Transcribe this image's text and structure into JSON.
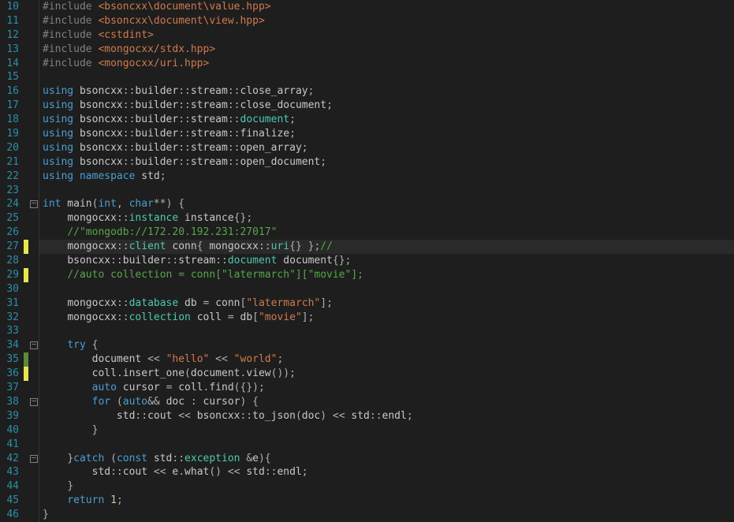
{
  "gutter": {
    "start": 10,
    "end": 46
  },
  "foldMarks": {
    "24": "box",
    "34": "box",
    "38": "box",
    "42": "box"
  },
  "markers": {
    "27": "yellow",
    "29": "yellow",
    "35": "green",
    "36": "yellow"
  },
  "currentLine": 27,
  "lines": [
    {
      "n": 10,
      "tokens": [
        [
          "k-preproc",
          "#include "
        ],
        [
          "k-string",
          "<bsoncxx\\document\\value.hpp>"
        ]
      ]
    },
    {
      "n": 11,
      "tokens": [
        [
          "k-preproc",
          "#include "
        ],
        [
          "k-string",
          "<bsoncxx\\document\\view.hpp>"
        ]
      ]
    },
    {
      "n": 12,
      "tokens": [
        [
          "k-preproc",
          "#include "
        ],
        [
          "k-string",
          "<cstdint>"
        ]
      ]
    },
    {
      "n": 13,
      "tokens": [
        [
          "k-preproc",
          "#include "
        ],
        [
          "k-string",
          "<mongocxx/stdx.hpp>"
        ]
      ]
    },
    {
      "n": 14,
      "tokens": [
        [
          "k-preproc",
          "#include "
        ],
        [
          "k-string",
          "<mongocxx/uri.hpp>"
        ]
      ]
    },
    {
      "n": 15,
      "tokens": []
    },
    {
      "n": 16,
      "tokens": [
        [
          "k-keyword",
          "using"
        ],
        [
          "k-ident",
          " bsoncxx"
        ],
        [
          "k-scope",
          "::"
        ],
        [
          "k-ident",
          "builder"
        ],
        [
          "k-scope",
          "::"
        ],
        [
          "k-ident",
          "stream"
        ],
        [
          "k-scope",
          "::"
        ],
        [
          "k-ident",
          "close_array"
        ],
        [
          "k-punct",
          ";"
        ]
      ]
    },
    {
      "n": 17,
      "tokens": [
        [
          "k-keyword",
          "using"
        ],
        [
          "k-ident",
          " bsoncxx"
        ],
        [
          "k-scope",
          "::"
        ],
        [
          "k-ident",
          "builder"
        ],
        [
          "k-scope",
          "::"
        ],
        [
          "k-ident",
          "stream"
        ],
        [
          "k-scope",
          "::"
        ],
        [
          "k-ident",
          "close_document"
        ],
        [
          "k-punct",
          ";"
        ]
      ]
    },
    {
      "n": 18,
      "tokens": [
        [
          "k-keyword",
          "using"
        ],
        [
          "k-ident",
          " bsoncxx"
        ],
        [
          "k-scope",
          "::"
        ],
        [
          "k-ident",
          "builder"
        ],
        [
          "k-scope",
          "::"
        ],
        [
          "k-ident",
          "stream"
        ],
        [
          "k-scope",
          "::"
        ],
        [
          "k-class",
          "document"
        ],
        [
          "k-punct",
          ";"
        ]
      ]
    },
    {
      "n": 19,
      "tokens": [
        [
          "k-keyword",
          "using"
        ],
        [
          "k-ident",
          " bsoncxx"
        ],
        [
          "k-scope",
          "::"
        ],
        [
          "k-ident",
          "builder"
        ],
        [
          "k-scope",
          "::"
        ],
        [
          "k-ident",
          "stream"
        ],
        [
          "k-scope",
          "::"
        ],
        [
          "k-ident",
          "finalize"
        ],
        [
          "k-punct",
          ";"
        ]
      ]
    },
    {
      "n": 20,
      "tokens": [
        [
          "k-keyword",
          "using"
        ],
        [
          "k-ident",
          " bsoncxx"
        ],
        [
          "k-scope",
          "::"
        ],
        [
          "k-ident",
          "builder"
        ],
        [
          "k-scope",
          "::"
        ],
        [
          "k-ident",
          "stream"
        ],
        [
          "k-scope",
          "::"
        ],
        [
          "k-ident",
          "open_array"
        ],
        [
          "k-punct",
          ";"
        ]
      ]
    },
    {
      "n": 21,
      "tokens": [
        [
          "k-keyword",
          "using"
        ],
        [
          "k-ident",
          " bsoncxx"
        ],
        [
          "k-scope",
          "::"
        ],
        [
          "k-ident",
          "builder"
        ],
        [
          "k-scope",
          "::"
        ],
        [
          "k-ident",
          "stream"
        ],
        [
          "k-scope",
          "::"
        ],
        [
          "k-ident",
          "open_document"
        ],
        [
          "k-punct",
          ";"
        ]
      ]
    },
    {
      "n": 22,
      "tokens": [
        [
          "k-keyword",
          "using"
        ],
        [
          "k-ident",
          " "
        ],
        [
          "k-keyword",
          "namespace"
        ],
        [
          "k-ident",
          " std"
        ],
        [
          "k-punct",
          ";"
        ]
      ]
    },
    {
      "n": 23,
      "tokens": []
    },
    {
      "n": 24,
      "tokens": [
        [
          "k-keyword",
          "int"
        ],
        [
          "k-ident",
          " main"
        ],
        [
          "k-paren",
          "("
        ],
        [
          "k-keyword",
          "int"
        ],
        [
          "k-punct",
          ", "
        ],
        [
          "k-keyword",
          "char"
        ],
        [
          "k-punct",
          "**"
        ],
        [
          "k-paren",
          ") {"
        ]
      ]
    },
    {
      "n": 25,
      "indent": "    ",
      "tokens": [
        [
          "k-ident",
          "mongocxx"
        ],
        [
          "k-scope",
          "::"
        ],
        [
          "k-class",
          "instance"
        ],
        [
          "k-ident",
          " instance"
        ],
        [
          "k-paren",
          "{}"
        ],
        [
          "k-punct",
          ";"
        ]
      ]
    },
    {
      "n": 26,
      "indent": "    ",
      "tokens": [
        [
          "k-comment",
          "//\"mongodb://172.20.192.231:27017\""
        ]
      ]
    },
    {
      "n": 27,
      "indent": "    ",
      "tokens": [
        [
          "k-ident",
          "mongocxx"
        ],
        [
          "k-scope",
          "::"
        ],
        [
          "k-class",
          "client"
        ],
        [
          "k-ident",
          " conn"
        ],
        [
          "k-paren",
          "{ "
        ],
        [
          "k-ident",
          "mongocxx"
        ],
        [
          "k-scope",
          "::"
        ],
        [
          "k-class",
          "uri"
        ],
        [
          "k-paren",
          "{} }"
        ],
        [
          "k-punct",
          ";"
        ],
        [
          "k-comment",
          "//"
        ]
      ]
    },
    {
      "n": 28,
      "indent": "    ",
      "tokens": [
        [
          "k-ident",
          "bsoncxx"
        ],
        [
          "k-scope",
          "::"
        ],
        [
          "k-ident",
          "builder"
        ],
        [
          "k-scope",
          "::"
        ],
        [
          "k-ident",
          "stream"
        ],
        [
          "k-scope",
          "::"
        ],
        [
          "k-class",
          "document"
        ],
        [
          "k-ident",
          " document"
        ],
        [
          "k-paren",
          "{}"
        ],
        [
          "k-punct",
          ";"
        ]
      ]
    },
    {
      "n": 29,
      "indent": "    ",
      "tokens": [
        [
          "k-comment",
          "//auto collection = conn[\"latermarch\"][\"movie\"];"
        ]
      ]
    },
    {
      "n": 30,
      "tokens": []
    },
    {
      "n": 31,
      "indent": "    ",
      "tokens": [
        [
          "k-ident",
          "mongocxx"
        ],
        [
          "k-scope",
          "::"
        ],
        [
          "k-class",
          "database"
        ],
        [
          "k-ident",
          " db "
        ],
        [
          "k-punct",
          "= "
        ],
        [
          "k-ident",
          "conn"
        ],
        [
          "k-paren",
          "["
        ],
        [
          "k-string",
          "\"latermarch\""
        ],
        [
          "k-paren",
          "]"
        ],
        [
          "k-punct",
          ";"
        ]
      ]
    },
    {
      "n": 32,
      "indent": "    ",
      "tokens": [
        [
          "k-ident",
          "mongocxx"
        ],
        [
          "k-scope",
          "::"
        ],
        [
          "k-class",
          "collection"
        ],
        [
          "k-ident",
          " coll "
        ],
        [
          "k-punct",
          "= "
        ],
        [
          "k-ident",
          "db"
        ],
        [
          "k-paren",
          "["
        ],
        [
          "k-string",
          "\"movie\""
        ],
        [
          "k-paren",
          "]"
        ],
        [
          "k-punct",
          ";"
        ]
      ]
    },
    {
      "n": 33,
      "tokens": []
    },
    {
      "n": 34,
      "indent": "    ",
      "tokens": [
        [
          "k-keyword",
          "try"
        ],
        [
          "k-paren",
          " {"
        ]
      ]
    },
    {
      "n": 35,
      "indent": "        ",
      "tokens": [
        [
          "k-ident",
          "document "
        ],
        [
          "k-punct",
          "<< "
        ],
        [
          "k-string",
          "\"hello\""
        ],
        [
          "k-punct",
          " << "
        ],
        [
          "k-string",
          "\"world\""
        ],
        [
          "k-punct",
          ";"
        ]
      ]
    },
    {
      "n": 36,
      "indent": "        ",
      "tokens": [
        [
          "k-ident",
          "coll"
        ],
        [
          "k-punct",
          "."
        ],
        [
          "k-func",
          "insert_one"
        ],
        [
          "k-paren",
          "("
        ],
        [
          "k-ident",
          "document"
        ],
        [
          "k-punct",
          "."
        ],
        [
          "k-func",
          "view"
        ],
        [
          "k-paren",
          "())"
        ],
        [
          "k-punct",
          ";"
        ]
      ]
    },
    {
      "n": 37,
      "indent": "        ",
      "tokens": [
        [
          "k-keyword",
          "auto"
        ],
        [
          "k-ident",
          " cursor "
        ],
        [
          "k-punct",
          "= "
        ],
        [
          "k-ident",
          "coll"
        ],
        [
          "k-punct",
          "."
        ],
        [
          "k-func",
          "find"
        ],
        [
          "k-paren",
          "({})"
        ],
        [
          "k-punct",
          ";"
        ]
      ]
    },
    {
      "n": 38,
      "indent": "        ",
      "tokens": [
        [
          "k-keyword",
          "for"
        ],
        [
          "k-paren",
          " ("
        ],
        [
          "k-keyword",
          "auto"
        ],
        [
          "k-punct",
          "&& "
        ],
        [
          "k-ident",
          "doc "
        ],
        [
          "k-punct",
          ": "
        ],
        [
          "k-ident",
          "cursor"
        ],
        [
          "k-paren",
          ") {"
        ]
      ]
    },
    {
      "n": 39,
      "indent": "            ",
      "tokens": [
        [
          "k-ident",
          "std"
        ],
        [
          "k-scope",
          "::"
        ],
        [
          "k-ident",
          "cout "
        ],
        [
          "k-punct",
          "<< "
        ],
        [
          "k-ident",
          "bsoncxx"
        ],
        [
          "k-scope",
          "::"
        ],
        [
          "k-func",
          "to_json"
        ],
        [
          "k-paren",
          "("
        ],
        [
          "k-ident",
          "doc"
        ],
        [
          "k-paren",
          ")"
        ],
        [
          "k-punct",
          " << "
        ],
        [
          "k-ident",
          "std"
        ],
        [
          "k-scope",
          "::"
        ],
        [
          "k-ident",
          "endl"
        ],
        [
          "k-punct",
          ";"
        ]
      ]
    },
    {
      "n": 40,
      "indent": "        ",
      "tokens": [
        [
          "k-paren",
          "}"
        ]
      ]
    },
    {
      "n": 41,
      "tokens": []
    },
    {
      "n": 42,
      "indent": "    ",
      "tokens": [
        [
          "k-paren",
          "}"
        ],
        [
          "k-keyword",
          "catch"
        ],
        [
          "k-paren",
          " ("
        ],
        [
          "k-keyword",
          "const"
        ],
        [
          "k-ident",
          " std"
        ],
        [
          "k-scope",
          "::"
        ],
        [
          "k-class",
          "exception"
        ],
        [
          "k-ident",
          " "
        ],
        [
          "k-punct",
          "&"
        ],
        [
          "k-ident",
          "e"
        ],
        [
          "k-paren",
          "){"
        ]
      ]
    },
    {
      "n": 43,
      "indent": "        ",
      "tokens": [
        [
          "k-ident",
          "std"
        ],
        [
          "k-scope",
          "::"
        ],
        [
          "k-ident",
          "cout "
        ],
        [
          "k-punct",
          "<< "
        ],
        [
          "k-ident",
          "e"
        ],
        [
          "k-punct",
          "."
        ],
        [
          "k-func",
          "what"
        ],
        [
          "k-paren",
          "()"
        ],
        [
          "k-punct",
          " << "
        ],
        [
          "k-ident",
          "std"
        ],
        [
          "k-scope",
          "::"
        ],
        [
          "k-ident",
          "endl"
        ],
        [
          "k-punct",
          ";"
        ]
      ]
    },
    {
      "n": 44,
      "indent": "    ",
      "tokens": [
        [
          "k-paren",
          "}"
        ]
      ]
    },
    {
      "n": 45,
      "indent": "    ",
      "tokens": [
        [
          "k-keyword",
          "return"
        ],
        [
          "k-ident",
          " "
        ],
        [
          "k-num",
          "1"
        ],
        [
          "k-punct",
          ";"
        ]
      ]
    },
    {
      "n": 46,
      "tokens": [
        [
          "k-paren",
          "}"
        ]
      ]
    }
  ]
}
